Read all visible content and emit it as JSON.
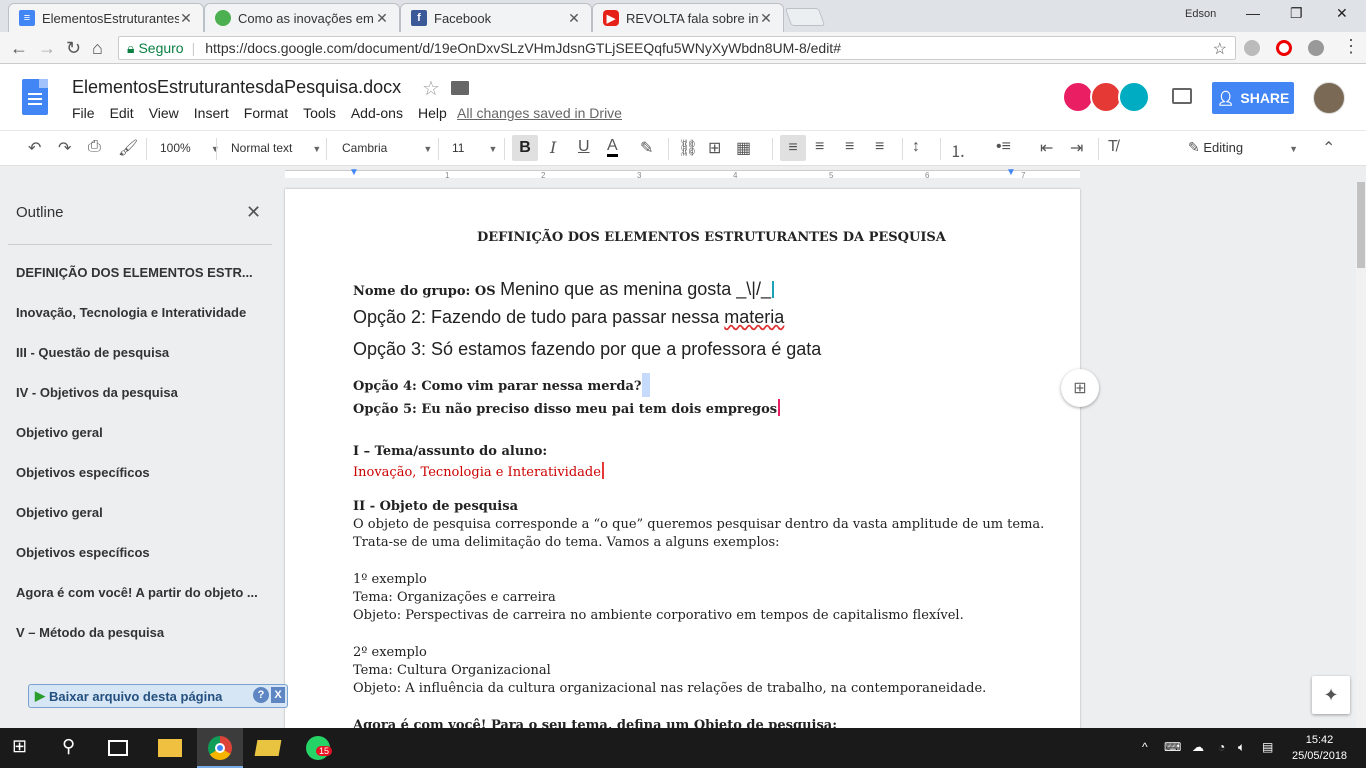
{
  "browser": {
    "tabs": [
      {
        "title": "ElementosEstruturantesda",
        "favicon": "docs-icon",
        "color": "#4285f4"
      },
      {
        "title": "Como as inovações em te",
        "favicon": "leaf-icon",
        "color": "#4caf50"
      },
      {
        "title": "Facebook",
        "favicon": "facebook-icon",
        "color": "#3b5998"
      },
      {
        "title": "REVOLTA fala sobre infân",
        "favicon": "youtube-icon",
        "color": "#e62117"
      }
    ],
    "user": "Edson",
    "secure_label": "Seguro",
    "url": "https://docs.google.com/document/d/19eOnDxvSLzVHmJdsnGTLjSEEQqfu5WNyXyWbdn8UM-8/edit#"
  },
  "docs": {
    "title": "ElementosEstruturantesdaPesquisa.docx",
    "menu": [
      "File",
      "Edit",
      "View",
      "Insert",
      "Format",
      "Tools",
      "Add-ons",
      "Help"
    ],
    "saved_status": "All changes saved in Drive",
    "share_label": "SHARE",
    "accent": "#4285f4"
  },
  "toolbar": {
    "zoom": "100%",
    "style": "Normal text",
    "font": "Cambria",
    "size": "11",
    "mode": "Editing"
  },
  "ruler": [
    "1",
    "1",
    "2",
    "3",
    "4",
    "5",
    "6",
    "7"
  ],
  "outline": {
    "title": "Outline",
    "items": [
      "DEFINIÇÃO DOS ELEMENTOS ESTR...",
      "Inovação, Tecnologia e Interatividade",
      "III - Questão de pesquisa",
      "IV - Objetivos da pesquisa",
      "Objetivo geral",
      "Objetivos específicos",
      "Objetivo geral",
      "Objetivos específicos",
      "Agora é com você! A partir do objeto ...",
      "V – Método da pesquisa"
    ]
  },
  "addon_bar": {
    "label": "Baixar arquivo desta página",
    "help": "?",
    "close": "X"
  },
  "document": {
    "heading": "DEFINIÇÃO DOS ELEMENTOS ESTRUTURANTES DA PESQUISA",
    "group_label": "Nome do grupo: OS",
    "group_value": "Menino que as menina gosta _\\|/_",
    "opcao2_a": "Opção 2: Fazendo de tudo para passar nessa ",
    "opcao2_b": "materia",
    "opcao3": "Opção 3: Só estamos fazendo por que a professora é gata",
    "opcao4": "Opção 4: Como vim parar nessa merda?",
    "opcao5": "Opção 5: Eu não preciso disso meu pai tem dois empregos",
    "tema_head": "I – Tema/assunto do aluno:",
    "tema_value": "Inovação, Tecnologia e Interatividade",
    "objeto_head": "II - Objeto de pesquisa",
    "objeto_p1": "O objeto de pesquisa corresponde a “o que” queremos pesquisar dentro da vasta amplitude de um tema.",
    "objeto_p2": "Trata-se de uma delimitação do tema. Vamos a alguns exemplos:",
    "ex1_head": "1º exemplo",
    "ex1_tema": "Tema: Organizações e carreira",
    "ex1_obj": "Objeto: Perspectivas de carreira no ambiente corporativo em tempos de capitalismo flexível.",
    "ex2_head": "2º exemplo",
    "ex2_tema": "Tema: Cultura Organizacional",
    "ex2_obj": "Objeto: A influência da cultura organizacional nas relações de trabalho, na contemporaneidade.",
    "agora": "Agora é com você! Para o seu tema, defina um Objeto de pesquisa:"
  },
  "taskbar": {
    "time": "15:42",
    "date": "25/05/2018",
    "whatsapp_badge": "15"
  }
}
